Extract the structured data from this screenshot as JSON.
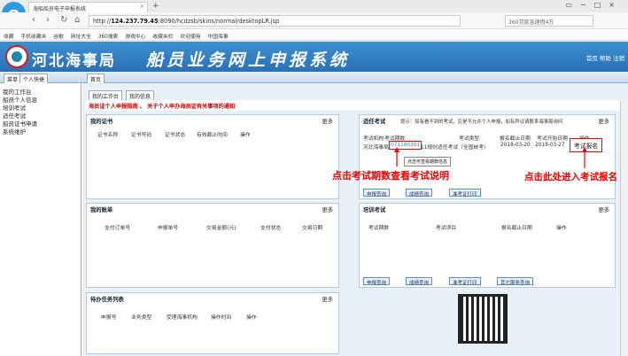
{
  "browser": {
    "tab_title": "海船船员电子申报系统",
    "url_prefix": "http://",
    "url_host": "124.237.79.45",
    "url_path": ":8090/hcdzsb/skins/normal/desktopLR.jsp",
    "search_placeholder": "360贷款急速借4万",
    "bookmarks": [
      "收藏",
      "手机收藏夹",
      "谷歌",
      "网址大全",
      "360搜索",
      "游戏中心",
      "收藏夹栏",
      "欢迎使用",
      "中国海事"
    ]
  },
  "site": {
    "title": "河北海事局",
    "subtitle": "船员业务网上申报系统",
    "top_links": "首页 帮助 注销"
  },
  "nav": {
    "menu_tabs": [
      "菜单",
      "个人快捷"
    ],
    "home_tab": "首页"
  },
  "sidebar": {
    "items": [
      "我的工作台",
      "船员个人信息",
      "培训考试",
      "适任考试",
      "船员证书申请",
      "系统维护"
    ]
  },
  "content": {
    "sub_tabs": [
      "我的工作台",
      "我的信息"
    ],
    "notice": "海员证个人申报指南 、 关于个人申办海员证有关事项的通知",
    "certs": {
      "title": "我的证书",
      "more": "更多",
      "columns": [
        "证书名称",
        "证书号码",
        "证书状态",
        "有效截止时间",
        "操作"
      ]
    },
    "exam": {
      "title": "适任考试",
      "hint": "提示：如有看不到的考试，应是不允许个人申报，如有异议请联系海事局询问",
      "more": "更多",
      "columns": [
        "考试机构",
        "考试期数",
        "考试类型",
        "报名截止日期",
        "考试开始日期",
        "操作"
      ],
      "row": {
        "org": "河北海事局",
        "period": "071180301",
        "type": "11规则适任考试（全国统考）",
        "deadline": "2018-03-20",
        "start": "2018-03-27",
        "action": "考试报名"
      },
      "tooltip": "点击可查看期数信息",
      "buttons": [
        "申报查询",
        "成绩查询",
        "准考证打印"
      ]
    },
    "bills": {
      "title": "我的账单",
      "more": "更多",
      "columns": [
        "支付订单号",
        "申报单号",
        "交易金额(元)",
        "支付状态",
        "交易日期"
      ]
    },
    "training": {
      "title": "培训考试",
      "more": "更多",
      "columns": [
        "考试期数",
        "考试项目",
        "报名截止日期",
        "操作"
      ],
      "buttons": [
        "申报查询",
        "成绩查询",
        "准考证打印",
        "其它服务查询"
      ]
    },
    "tasks": {
      "title": "待办任务列表",
      "more": "更多",
      "columns": [
        "申报号",
        "业务类型",
        "受理海事机构",
        "操作时间",
        "操作"
      ]
    },
    "annotation_left": "点击考试期数查看考试说明",
    "annotation_right": "点击此处进入考试报名"
  }
}
